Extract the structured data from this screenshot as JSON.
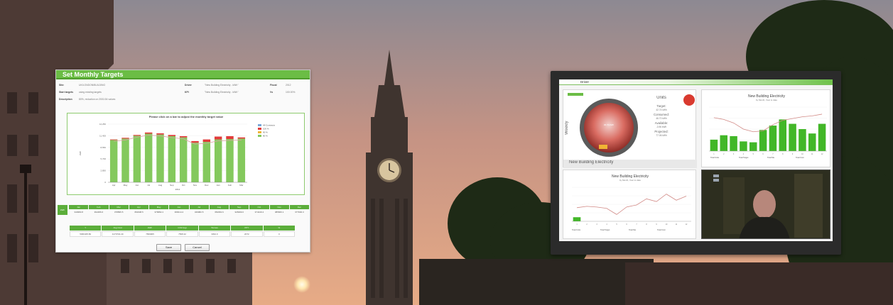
{
  "colors": {
    "brand_green": "#6bbd45",
    "target_line": "#d9a2a0",
    "bar_green": "#84c95d",
    "overshoot_red": "#e23b3b",
    "overshoot_amber": "#f0b434",
    "sky_top": "#8d8992",
    "sky_bottom": "#e7ab86"
  },
  "background": {
    "description_icon": "big-ben-photo"
  },
  "targets_panel": {
    "title": "Set Monthly Targets",
    "fields": {
      "site_label": "Site:",
      "site_value": "UK/LONDON/BUILDING",
      "driver_label": "Driver",
      "driver_value": "\"New Building Electricity - kWh\"",
      "fiscal_label": "Fiscal",
      "fiscal_value": "2012",
      "start_label": "Start targets",
      "start_value": "using existing targets",
      "kpi_label": "KPI",
      "kpi_value": "\"New Building Electricity - kWh\"",
      "vs_label": "Vs",
      "vs_value": "100.00%",
      "desc_label": "Description",
      "desc_value": "80%, reduction on 2001/04 values"
    },
    "chart_heading": "Please click on a bar to adjust the monthly target value",
    "table_months": [
      "Jan",
      "Feb",
      "Mar",
      "Apr",
      "May",
      "Jun",
      "Jul",
      "Aug",
      "Sep",
      "Oct",
      "Nov",
      "Dec"
    ],
    "table_values": [
      "340983.8",
      "362486.6",
      "378895.5",
      "354608.5",
      "376882.4",
      "368414.2",
      "346982.5",
      "352963.6",
      "326999.0",
      "374449.4",
      "385666.1",
      "377600.3"
    ],
    "table_first_label": "kWh",
    "summary_headers": [
      "Y",
      "Avg Cost",
      "kWh",
      "CO2 (kg)",
      "Tonnes",
      "PPY",
      "%"
    ],
    "summary_values": [
      "5966405.80",
      "4179704.40",
      "7839905",
      "7568.42",
      "3394.0",
      "2072",
      "0"
    ],
    "save_label": "Save",
    "cancel_label": "Cancel"
  },
  "dashboard": {
    "window_title": "Driver",
    "gauge_tile": {
      "label_weekly": "Weekly",
      "units_title": "Units",
      "target_label": "Target:",
      "target_value": "42.74 kWh",
      "consumed_label": "Consumed:",
      "consumed_value": "46.70 kWh",
      "available_label": "Available:",
      "available_value": "-3.96 kWh",
      "projected_label": "Projected:",
      "projected_value": "77.06 kWh",
      "name": "New Building Electricity",
      "gauge_text": "46.70 kWh"
    },
    "top_chart": {
      "title": "New Building Electricity",
      "subtitle": "by Month, Year to date"
    },
    "bottom_chart": {
      "title": "New Building Electricity",
      "subtitle": "by Month, Year to date"
    },
    "summary_labels": [
      "Total Units",
      "Total Target",
      "Total Ma",
      "Total Cost"
    ]
  },
  "chart_data": [
    {
      "type": "bar",
      "title": "Please click on a bar to adjust the monthly target value",
      "xlabel": "2012",
      "ylabel": "kWh",
      "categories": [
        "Apr",
        "May",
        "Jun",
        "Jul",
        "Aug",
        "Sep",
        "Oct",
        "Nov",
        "Dec",
        "Jan",
        "Feb",
        "Mar"
      ],
      "ylim": [
        0,
        14250
      ],
      "y_ticks": [
        "0",
        "2,850",
        "5,700",
        "8,550",
        "11,400",
        "14,250"
      ],
      "series": [
        {
          "name": "All Contracts",
          "values": [
            10500,
            10900,
            11600,
            12200,
            12000,
            11600,
            11300,
            10100,
            10500,
            11200,
            11300,
            11000
          ]
        },
        {
          "name": "100 %",
          "values": [
            10400,
            10700,
            11400,
            11900,
            11700,
            11300,
            11000,
            9700,
            9900,
            10500,
            10600,
            10700
          ]
        }
      ],
      "legend": [
        "All Contracts",
        "100 %",
        "90 %",
        "80 %"
      ],
      "legend_position": "right",
      "grid": true
    },
    {
      "type": "bar",
      "title": "New Building Electricity",
      "subtitle": "by Month, Year to date",
      "categories": [
        "1",
        "2",
        "3",
        "4",
        "5",
        "6",
        "7",
        "8",
        "9",
        "10",
        "11",
        "12"
      ],
      "series": [
        {
          "name": "units",
          "values": [
            26,
            36,
            34,
            22,
            20,
            48,
            58,
            72,
            62,
            50,
            40,
            62
          ]
        },
        {
          "name": "target",
          "values": [
            76,
            72,
            64,
            50,
            44,
            46,
            60,
            70,
            74,
            78,
            80,
            84
          ]
        }
      ],
      "ylim": [
        0,
        100
      ]
    },
    {
      "type": "line",
      "title": "New Building Electricity",
      "subtitle": "by Month, Year to date",
      "categories": [
        "1",
        "2",
        "3",
        "4",
        "5",
        "6",
        "7",
        "8",
        "9",
        "10",
        "11",
        "12"
      ],
      "series": [
        {
          "name": "units",
          "values": [
            12,
            0,
            0,
            0,
            0,
            0,
            0,
            0,
            0,
            0,
            0,
            0
          ]
        },
        {
          "name": "target",
          "values": [
            40,
            44,
            42,
            38,
            20,
            42,
            48,
            66,
            58,
            80,
            62,
            74
          ]
        }
      ],
      "ylim": [
        0,
        100
      ]
    }
  ]
}
